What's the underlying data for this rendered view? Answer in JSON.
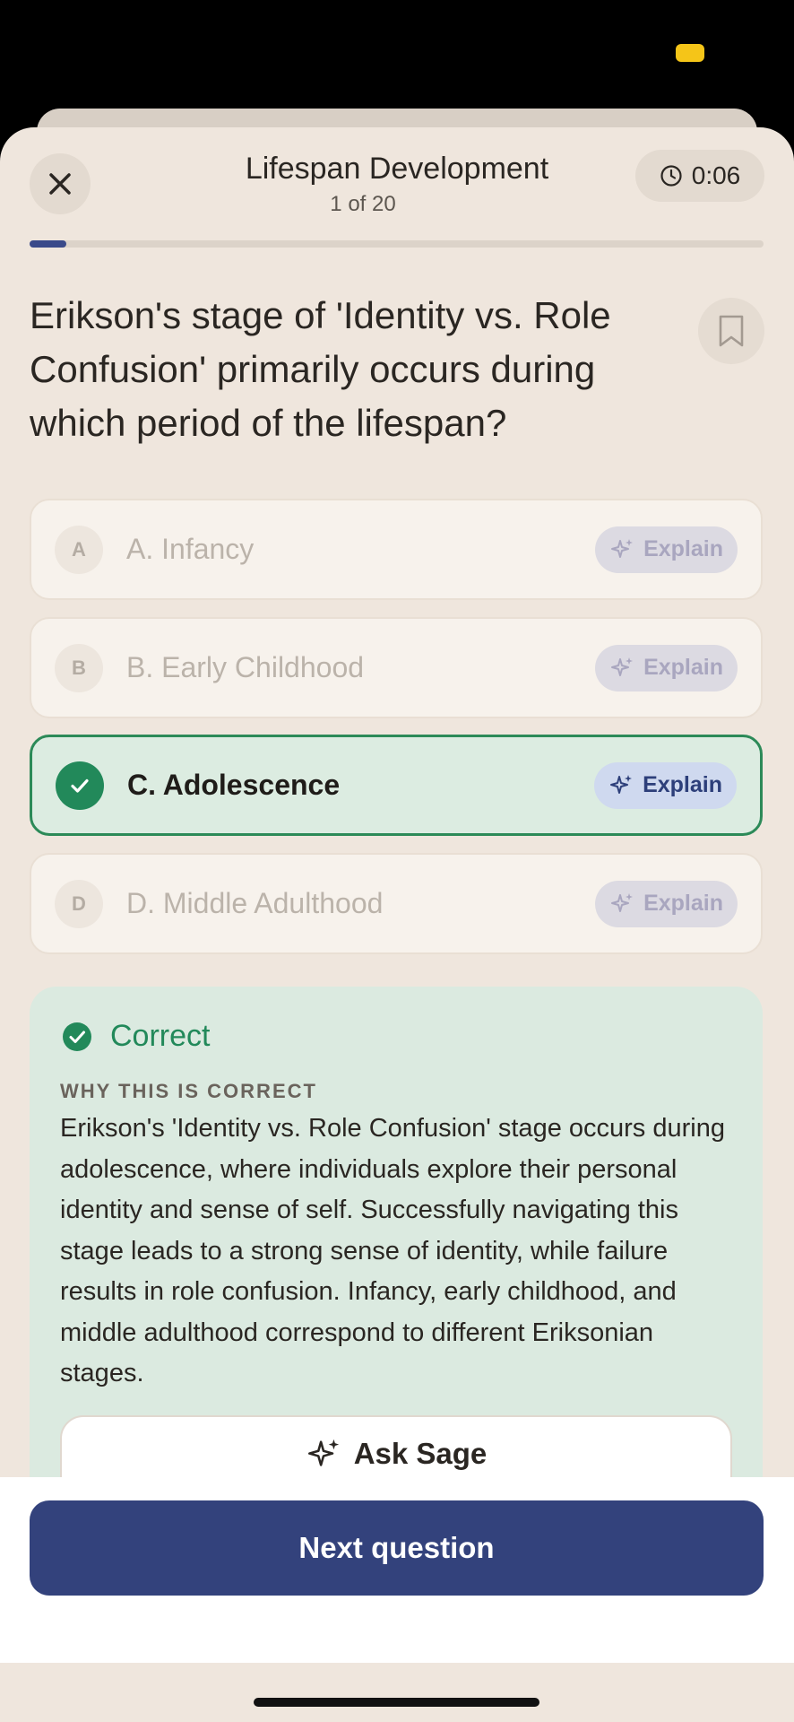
{
  "header": {
    "title": "Lifespan Development",
    "counter": "1 of 20",
    "timer": "0:06",
    "progress_fraction": 0.05
  },
  "question": {
    "text": "Erikson's stage of 'Identity vs. Role Confusion' primarily occurs during which period of the lifespan?"
  },
  "options": [
    {
      "letter": "A",
      "label": "A. Infancy",
      "explain": "Explain",
      "state": "dimmed"
    },
    {
      "letter": "B",
      "label": "B. Early Childhood",
      "explain": "Explain",
      "state": "dimmed"
    },
    {
      "letter": "C",
      "label": "C. Adolescence",
      "explain": "Explain",
      "state": "correct"
    },
    {
      "letter": "D",
      "label": "D. Middle Adulthood",
      "explain": "Explain",
      "state": "dimmed"
    }
  ],
  "feedback": {
    "title": "Correct",
    "caption": "WHY THIS IS CORRECT",
    "body": "Erikson's 'Identity vs. Role Confusion' stage occurs during adolescence, where individuals explore their personal identity and sense of self. Successfully navigating this stage leads to a strong sense of identity, while failure results in role confusion. Infancy, early childhood, and middle adulthood correspond to different Eriksonian stages.",
    "ask_label": "Ask Sage"
  },
  "footer": {
    "next_label": "Next question"
  },
  "colors": {
    "accent": "#33427c",
    "success": "#22895a",
    "background": "#efe6dd"
  }
}
